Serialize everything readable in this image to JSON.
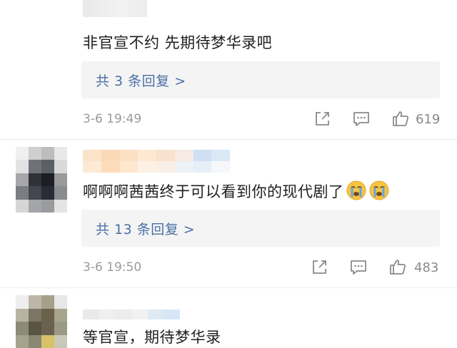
{
  "comments": [
    {
      "text": "非官宣不约 先期待梦华录吧",
      "replies_label": "共 3 条回复 >",
      "time": "3-6 19:49",
      "likes": "619"
    },
    {
      "text": "啊啊啊茜茜终于可以看到你的现代剧了",
      "emoji": [
        "crying-face-icon",
        "crying-face-icon"
      ],
      "replies_label": "共 13 条回复 >",
      "time": "3-6 19:50",
      "likes": "483"
    },
    {
      "text": "等官宣，期待梦华录"
    }
  ],
  "actions": {
    "share_icon": "share-icon",
    "comment_icon": "comment-icon",
    "like_icon": "thumbs-up-icon"
  },
  "colors": {
    "link": "#4a6fa5",
    "reply_bg": "#f4f4f4",
    "meta": "#9a9a9a"
  }
}
